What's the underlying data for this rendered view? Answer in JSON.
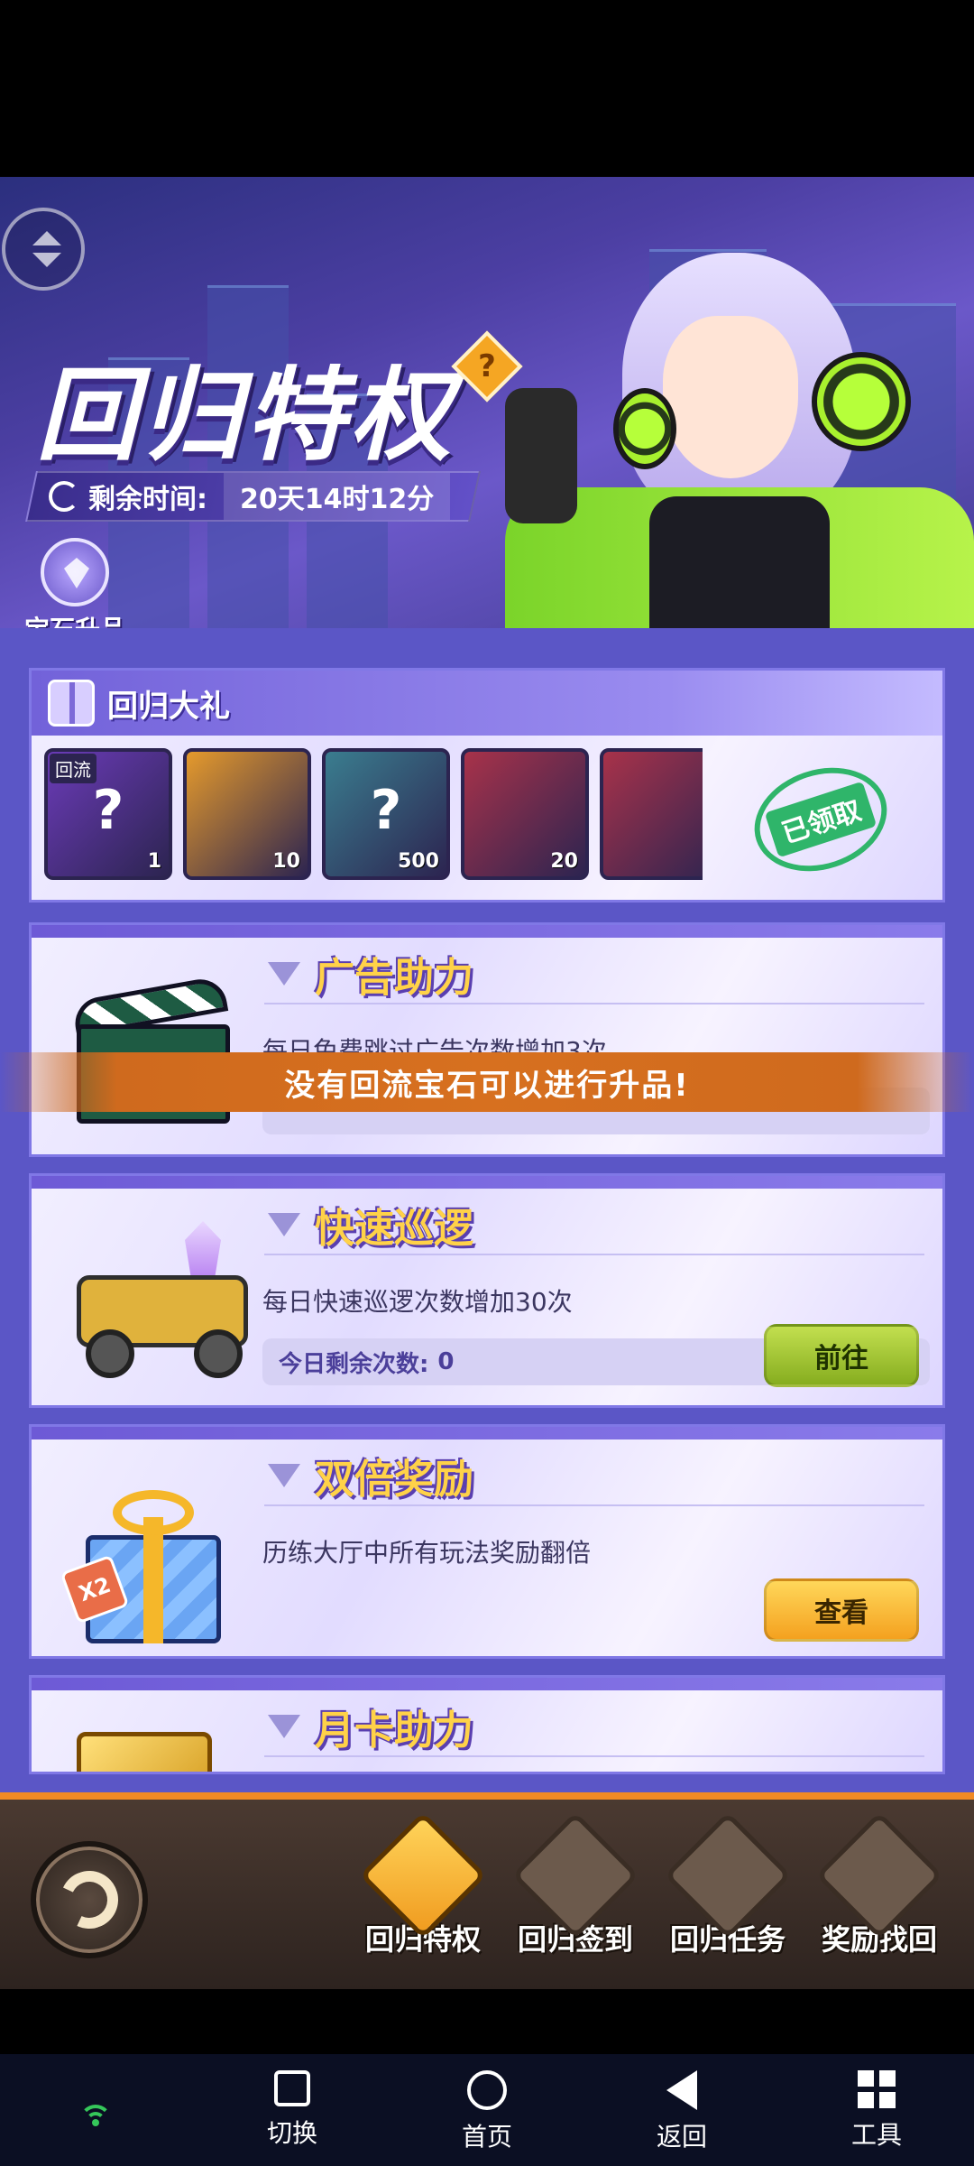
{
  "header": {
    "title": "回归特权",
    "help_glyph": "?",
    "timer_label": "剩余时间:",
    "timer_value": "20天14时12分",
    "gem_upgrade_label": "宝石升品"
  },
  "gift_section": {
    "title": "回归大礼",
    "items": [
      {
        "tag": "回流",
        "glyph": "?",
        "qty": "1",
        "color": "#6b3bb8"
      },
      {
        "tag": "",
        "glyph": "",
        "qty": "10",
        "color": "#e59a2c"
      },
      {
        "tag": "",
        "glyph": "?",
        "qty": "500",
        "color": "#3a7d8f"
      },
      {
        "tag": "",
        "glyph": "",
        "qty": "20",
        "color": "#a8324a"
      },
      {
        "tag": "",
        "glyph": "",
        "qty": "",
        "color": "#a8324a"
      }
    ],
    "stamp_text": "已领取"
  },
  "features": [
    {
      "name": "广告助力",
      "desc": "每日免费跳过广告次数增加3次",
      "progress_label": "",
      "progress_value": "",
      "button": ""
    },
    {
      "name": "快速巡逻",
      "desc": "每日快速巡逻次数增加30次",
      "progress_label": "今日剩余次数:",
      "progress_value": "0",
      "button": "前往"
    },
    {
      "name": "双倍奖励",
      "desc": "历练大厅中所有玩法奖励翻倍",
      "progress_label": "",
      "progress_value": "",
      "button": "查看"
    },
    {
      "name": "月卡助力",
      "desc": "",
      "progress_label": "",
      "progress_value": "",
      "button": ""
    }
  ],
  "toast": "没有回流宝石可以进行升品!",
  "bottom_tabs": [
    {
      "label": "回归特权",
      "active": true
    },
    {
      "label": "回归签到",
      "active": false
    },
    {
      "label": "回归任务",
      "active": false
    },
    {
      "label": "奖励找回",
      "active": false
    }
  ],
  "system_nav": [
    {
      "label": "切换"
    },
    {
      "label": "首页"
    },
    {
      "label": "返回"
    },
    {
      "label": "工具"
    }
  ],
  "colors": {
    "accent_orange": "#f08a25",
    "panel_purple": "#5b56c6",
    "toast_orange": "#d7701f",
    "wifi_green": "#35c75a"
  }
}
